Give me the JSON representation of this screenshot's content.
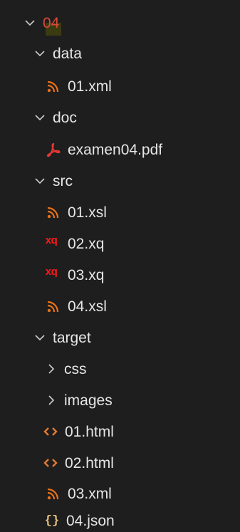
{
  "explorer": {
    "root": {
      "label": "04"
    },
    "data_folder": {
      "label": "data"
    },
    "data_01_xml": {
      "label": "01.xml"
    },
    "doc_folder": {
      "label": "doc"
    },
    "doc_examen04_pdf": {
      "label": "examen04.pdf"
    },
    "src_folder": {
      "label": "src"
    },
    "src_01_xsl": {
      "label": "01.xsl"
    },
    "src_02_xq": {
      "label": "02.xq"
    },
    "src_03_xq": {
      "label": "03.xq"
    },
    "src_04_xsl": {
      "label": "04.xsl"
    },
    "target_folder": {
      "label": "target"
    },
    "target_css": {
      "label": "css"
    },
    "target_images": {
      "label": "images"
    },
    "target_01_html": {
      "label": "01.html"
    },
    "target_02_html": {
      "label": "02.html"
    },
    "target_03_xml": {
      "label": "03.xml"
    },
    "target_04_json": {
      "label": "04.json"
    }
  },
  "icons": {
    "xquery_glyph": "xq",
    "json_glyph": "{}",
    "rss_color": "#e8711a",
    "pdf_color": "#e53935",
    "html_color": "#e37933",
    "xq_color": "#ff1a1a",
    "json_color": "#e5c07b"
  },
  "colors": {
    "background": "#1e1e1e",
    "text": "#e6e6e6",
    "root_text": "#d84a3a"
  }
}
